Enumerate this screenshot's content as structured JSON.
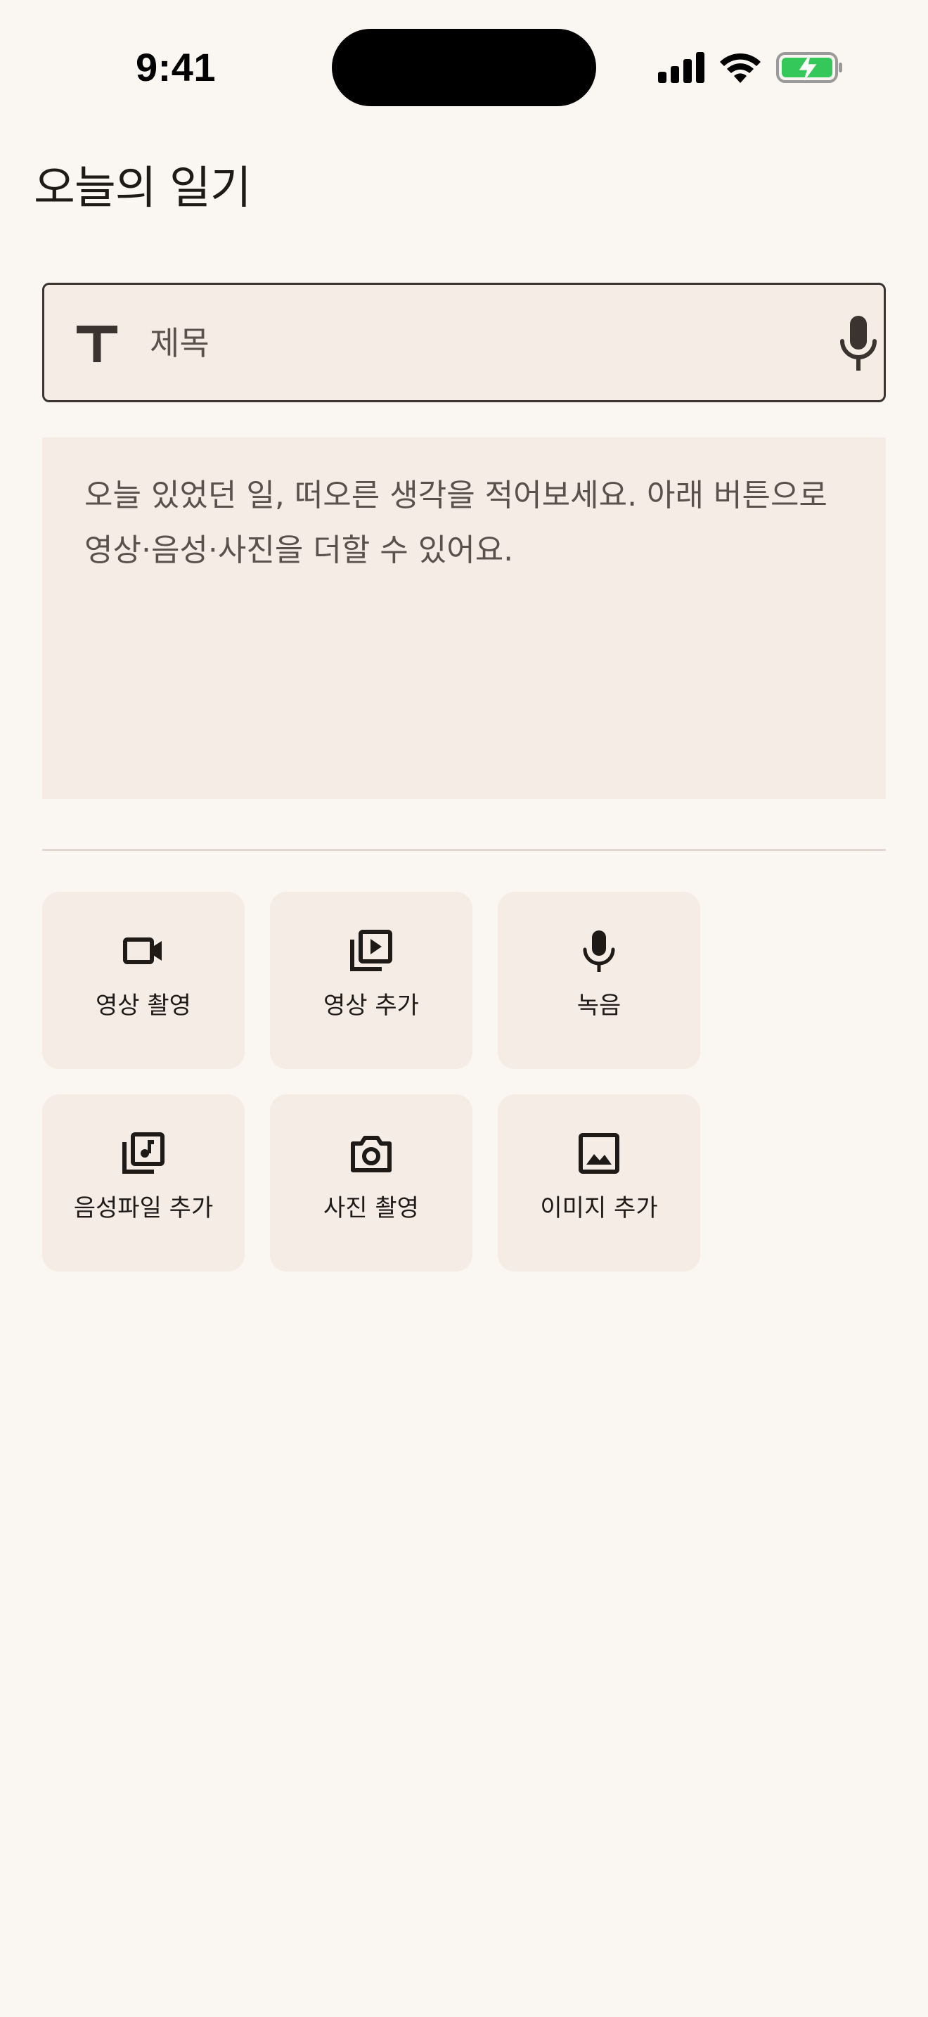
{
  "status_bar": {
    "time": "9:41"
  },
  "header": {
    "title": "오늘의 일기"
  },
  "title_field": {
    "value": "",
    "placeholder": "제목",
    "icon": "text-icon",
    "action_icon": "microphone-icon"
  },
  "body_field": {
    "value": "",
    "placeholder": "오늘 있었던 일, 떠오른 생각을 적어보세요. 아래 버튼으로 영상·음성·사진을 더할 수 있어요."
  },
  "attachments": [
    {
      "label": "영상 촬영",
      "icon": "video-camera-icon"
    },
    {
      "label": "영상 추가",
      "icon": "video-library-icon"
    },
    {
      "label": "녹음",
      "icon": "microphone-icon"
    },
    {
      "label": "음성파일 추가",
      "icon": "audio-library-icon"
    },
    {
      "label": "사진 촬영",
      "icon": "camera-icon"
    },
    {
      "label": "이미지 추가",
      "icon": "image-icon"
    }
  ],
  "colors": {
    "background": "#FAF6F1",
    "surface": "#F6ECE6",
    "text": "#1E1A18",
    "placeholder": "#5A514C",
    "battery": "#34C759"
  }
}
